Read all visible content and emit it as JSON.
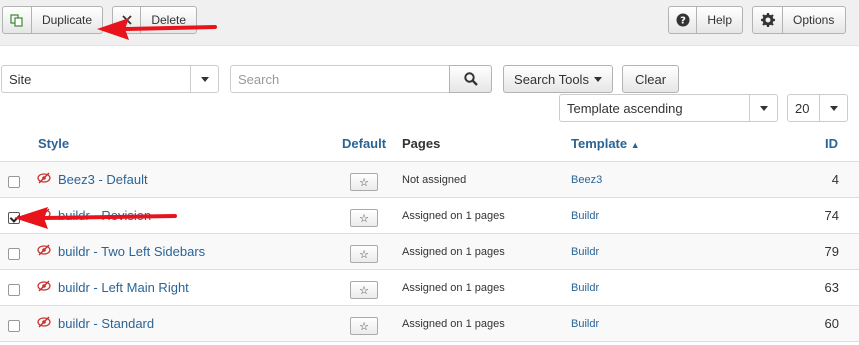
{
  "toolbar": {
    "duplicate_label": "Duplicate",
    "delete_label": "Delete",
    "help_label": "Help",
    "options_label": "Options"
  },
  "filters": {
    "site_value": "Site",
    "search_placeholder": "Search",
    "search_tools_label": "Search Tools",
    "clear_label": "Clear",
    "ordering_value": "Template ascending",
    "limit_value": "20"
  },
  "table": {
    "headers": {
      "style": "Style",
      "default": "Default",
      "pages": "Pages",
      "template": "Template",
      "id": "ID"
    },
    "rows": [
      {
        "style": "Beez3 - Default",
        "pages": "Not assigned",
        "template": "Beez3",
        "id": "4",
        "checked": false
      },
      {
        "style": "buildr - Revision",
        "pages": "Assigned on 1 pages",
        "template": "Buildr",
        "id": "74",
        "checked": true
      },
      {
        "style": "buildr - Two Left Sidebars",
        "pages": "Assigned on 1 pages",
        "template": "Buildr",
        "id": "79",
        "checked": false
      },
      {
        "style": "buildr - Left Main Right",
        "pages": "Assigned on 1 pages",
        "template": "Buildr",
        "id": "63",
        "checked": false
      },
      {
        "style": "buildr - Standard",
        "pages": "Assigned on 1 pages",
        "template": "Buildr",
        "id": "60",
        "checked": false
      }
    ]
  },
  "colors": {
    "link": "#2a6496",
    "annotation_arrow": "#e8141b"
  }
}
